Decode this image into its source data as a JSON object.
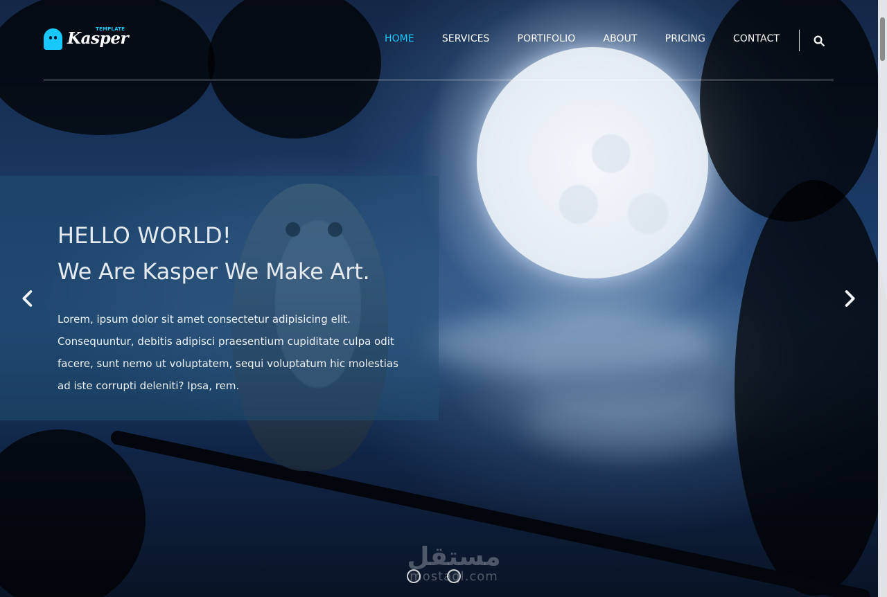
{
  "site": {
    "logo_small": "TEMPLATE",
    "logo_name": "Kasper"
  },
  "navigation": {
    "items": [
      {
        "label": "HOME",
        "active": true
      },
      {
        "label": "SERVICES",
        "active": false
      },
      {
        "label": "PORTIFOLIO",
        "active": false
      },
      {
        "label": "ABOUT",
        "active": false
      },
      {
        "label": "PRICING",
        "active": false
      },
      {
        "label": "CONTACT",
        "active": false
      }
    ],
    "search_icon": "search-icon"
  },
  "hero": {
    "title": "HELLO WORLD!",
    "subtitle": "We Are Kasper We Make Art.",
    "description": "Lorem, ipsum dolor sit amet consectetur adipisicing elit. Consequuntur, debitis adipisci praesentium cupiditate culpa odit facere, sunt nemo ut voluptatem, sequi voluptatum hic molestias ad iste corrupti deleniti? Ipsa, rem."
  },
  "carousel": {
    "previous_icon": "chevron-left-icon",
    "next_icon": "chevron-right-icon",
    "indicators": [
      "",
      ""
    ]
  },
  "watermark": {
    "arabic": "مستقل",
    "latin": "mostaql.com"
  },
  "colors": {
    "accent": "#19c8fa",
    "overlay": "#224f73",
    "text": "#ffffff"
  }
}
